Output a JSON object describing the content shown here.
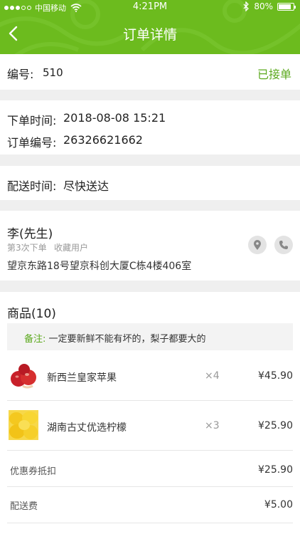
{
  "status_bar": {
    "carrier": "中国移动",
    "time": "4:21PM",
    "battery": "80%",
    "battery_level": 0.8
  },
  "nav": {
    "title": "订单详情"
  },
  "order_head": {
    "number_label": "编号:",
    "number_value": "510",
    "status": "已接单"
  },
  "order_info": {
    "time_label": "下单时间:",
    "time_value": "2018-08-08 15:21",
    "id_label": "订单编号:",
    "id_value": "26326621662"
  },
  "delivery": {
    "label": "配送时间:",
    "value": "尽快送达"
  },
  "customer": {
    "name": "李(先生)",
    "order_count": "第3次下单",
    "tag": "收藏用户",
    "address": "望京东路18号望京科创大厦C栋4楼406室"
  },
  "goods": {
    "title": "商品(10)",
    "note_label": "备注:",
    "note_text": "一定要新鲜不能有坏的，梨子都要大的",
    "items": [
      {
        "name": "新西兰皇家苹果",
        "qty": "×4",
        "price": "¥45.90",
        "icon": "apple-thumbnail"
      },
      {
        "name": "湖南古丈优选柠檬",
        "qty": "×3",
        "price": "¥25.90",
        "icon": "lemon-thumbnail"
      }
    ],
    "coupon_label": "优惠券抵扣",
    "coupon_value": "¥25.90",
    "delivery_fee_label": "配送费",
    "delivery_fee_value": "¥5.00"
  },
  "colors": {
    "brand_green": "#6cbb1e",
    "status_green": "#5ca91e"
  }
}
